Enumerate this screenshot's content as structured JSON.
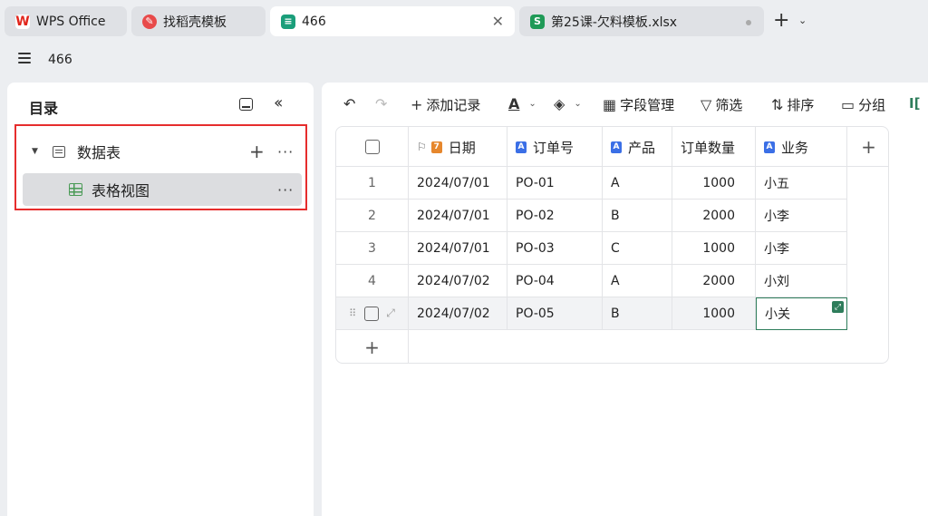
{
  "tabs": [
    {
      "label": "WPS Office",
      "icon": "wps-logo-icon",
      "color": "#e1251b"
    },
    {
      "label": "找稻壳模板",
      "icon": "docer-icon",
      "color": "#e84a4a"
    },
    {
      "label": "466",
      "icon": "multidim-table-icon",
      "color": "#1a9e7a",
      "active": true
    },
    {
      "label": "第25课-欠料模板.xlsx",
      "icon": "spreadsheet-icon",
      "color": "#1f9a57"
    }
  ],
  "window": {
    "title": "466"
  },
  "sidebar": {
    "title": "目录",
    "tree": [
      {
        "label": "数据表",
        "type": "table",
        "expanded": true
      },
      {
        "label": "表格视图",
        "type": "grid-view",
        "selected": true
      }
    ],
    "highlight_color": "#e62d2d"
  },
  "toolbar": {
    "add_record": "添加记录",
    "field_manage": "字段管理",
    "filter": "筛选",
    "sort": "排序",
    "group": "分组"
  },
  "table": {
    "columns": [
      {
        "label": "日期",
        "type": "date",
        "primary": true
      },
      {
        "label": "订单号",
        "type": "text"
      },
      {
        "label": "产品",
        "type": "text"
      },
      {
        "label": "订单数量",
        "type": "number"
      },
      {
        "label": "业务",
        "type": "text"
      }
    ],
    "rows": [
      {
        "no": "1",
        "date": "2024/07/01",
        "order": "PO-01",
        "product": "A",
        "qty": "1000",
        "rep": "小五"
      },
      {
        "no": "2",
        "date": "2024/07/01",
        "order": "PO-02",
        "product": "B",
        "qty": "2000",
        "rep": "小李"
      },
      {
        "no": "3",
        "date": "2024/07/01",
        "order": "PO-03",
        "product": "C",
        "qty": "1000",
        "rep": "小李"
      },
      {
        "no": "4",
        "date": "2024/07/02",
        "order": "PO-04",
        "product": "A",
        "qty": "2000",
        "rep": "小刘"
      },
      {
        "no": "",
        "date": "2024/07/02",
        "order": "PO-05",
        "product": "B",
        "qty": "1000",
        "rep": "小关"
      }
    ],
    "selected_cell": {
      "row": 5,
      "column": "业务"
    },
    "accent": "#2e7d5b"
  }
}
